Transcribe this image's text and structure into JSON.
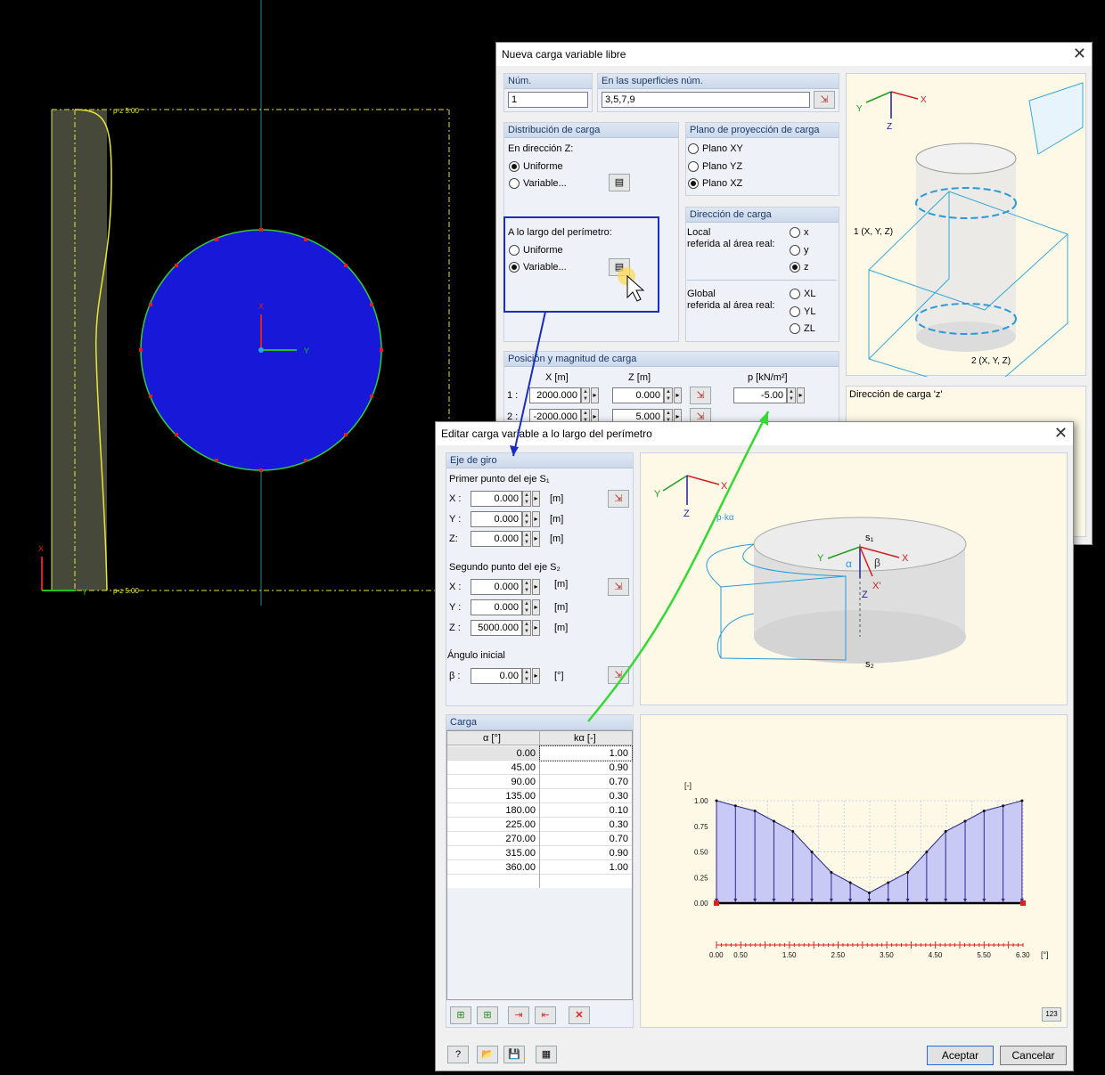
{
  "canvas": {
    "load_label_top": "p-z 5.00",
    "load_label_bottom": "p-z 5.00",
    "axis_x": "X",
    "axis_y": "Y",
    "axis_x2": "X",
    "axis_y2": "Y"
  },
  "dlg1": {
    "title": "Nueva carga variable libre",
    "num_label": "Núm.",
    "num_value": "1",
    "surf_label": "En las superficies núm.",
    "surf_value": "3,5,7,9",
    "dist_header": "Distribución de carga",
    "dir_z_label": "En dirección Z:",
    "uniforme": "Uniforme",
    "variable": "Variable...",
    "perim_label": "A lo largo del perímetro:",
    "uniforme2": "Uniforme",
    "variable2": "Variable...",
    "proj_header": "Plano de proyección de carga",
    "plano_xy": "Plano XY",
    "plano_yz": "Plano YZ",
    "plano_xz": "Plano XZ",
    "dircarga_header": "Dirección de carga",
    "local_l1": "Local",
    "local_l2": "referida al área real:",
    "opt_x": "x",
    "opt_y": "y",
    "opt_z": "z",
    "global_l1": "Global",
    "global_l2": "referida al área real:",
    "opt_xl": "XL",
    "opt_yl": "YL",
    "opt_zl": "ZL",
    "pos_header": "Posición y magnitud de carga",
    "col_x": "X  [m]",
    "col_z": "Z  [m]",
    "col_p": "p  [kN/m²]",
    "row1_idx": "1 :",
    "row1_x": "2000.000",
    "row1_z": "0.000",
    "row1_p": "-5.00",
    "row2_idx": "2 :",
    "row2_x": "-2000.000",
    "row2_z": "5.000",
    "fig_label1": "1 (X, Y, Z)",
    "fig_label2": "2 (X, Y, Z)",
    "fig_ax_x": "X",
    "fig_ax_y": "Y",
    "fig_ax_z": "Z",
    "dir_z_caption": "Dirección de carga 'z'"
  },
  "dlg2": {
    "title": "Editar carga variable a lo largo del perímetro",
    "eje_header": "Eje de giro",
    "p1_label": "Primer punto del eje S₁",
    "x_lbl": "X :",
    "y_lbl": "Y :",
    "z_lbl": "Z:",
    "z_lbl2": "Z :",
    "unit_m": "[m]",
    "p1_x": "0.000",
    "p1_y": "0.000",
    "p1_z": "0.000",
    "p2_label": "Segundo punto del eje S₂",
    "p2_x": "0.000",
    "p2_y": "0.000",
    "p2_z": "5000.000",
    "ang_label": "Ángulo inicial",
    "beta_lbl": "β :",
    "beta": "0.00",
    "unit_deg": "[°]",
    "carga_header": "Carga",
    "col_alpha": "α [°]",
    "col_k": "kα [-]",
    "rows": [
      [
        "0.00",
        "1.00"
      ],
      [
        "45.00",
        "0.90"
      ],
      [
        "90.00",
        "0.70"
      ],
      [
        "135.00",
        "0.30"
      ],
      [
        "180.00",
        "0.10"
      ],
      [
        "225.00",
        "0.30"
      ],
      [
        "270.00",
        "0.70"
      ],
      [
        "315.00",
        "0.90"
      ],
      [
        "360.00",
        "1.00"
      ]
    ],
    "fig": {
      "x": "X",
      "y": "Y",
      "z": "Z",
      "s1": "s₁",
      "s2": "s₂",
      "alpha": "α",
      "beta": "β",
      "xp": "X'",
      "zp": "Z",
      "ka": "p·kα"
    },
    "ok": "Aceptar",
    "cancel": "Cancelar"
  },
  "chart_data": {
    "type": "area",
    "title": "",
    "ylabel": "[-]",
    "xlabel": "[°]",
    "x": [
      0.0,
      0.39,
      0.79,
      1.18,
      1.57,
      1.96,
      2.36,
      2.75,
      3.14,
      3.53,
      3.93,
      4.32,
      4.71,
      5.11,
      5.5,
      5.89,
      6.28
    ],
    "values": [
      1.0,
      0.95,
      0.9,
      0.8,
      0.7,
      0.5,
      0.3,
      0.2,
      0.1,
      0.2,
      0.3,
      0.5,
      0.7,
      0.8,
      0.9,
      0.95,
      1.0
    ],
    "xlim": [
      0,
      6.3
    ],
    "ylim": [
      0,
      1.0
    ],
    "xticks": [
      "0.00",
      "0.50",
      "1.50",
      "2.50",
      "3.50",
      "4.50",
      "5.50",
      "6.30"
    ],
    "yticks": [
      "1.00",
      "0.75",
      "0.50",
      "0.25",
      "0.00"
    ],
    "fill": "#c9c9f6",
    "line": "#2a2a8a"
  }
}
